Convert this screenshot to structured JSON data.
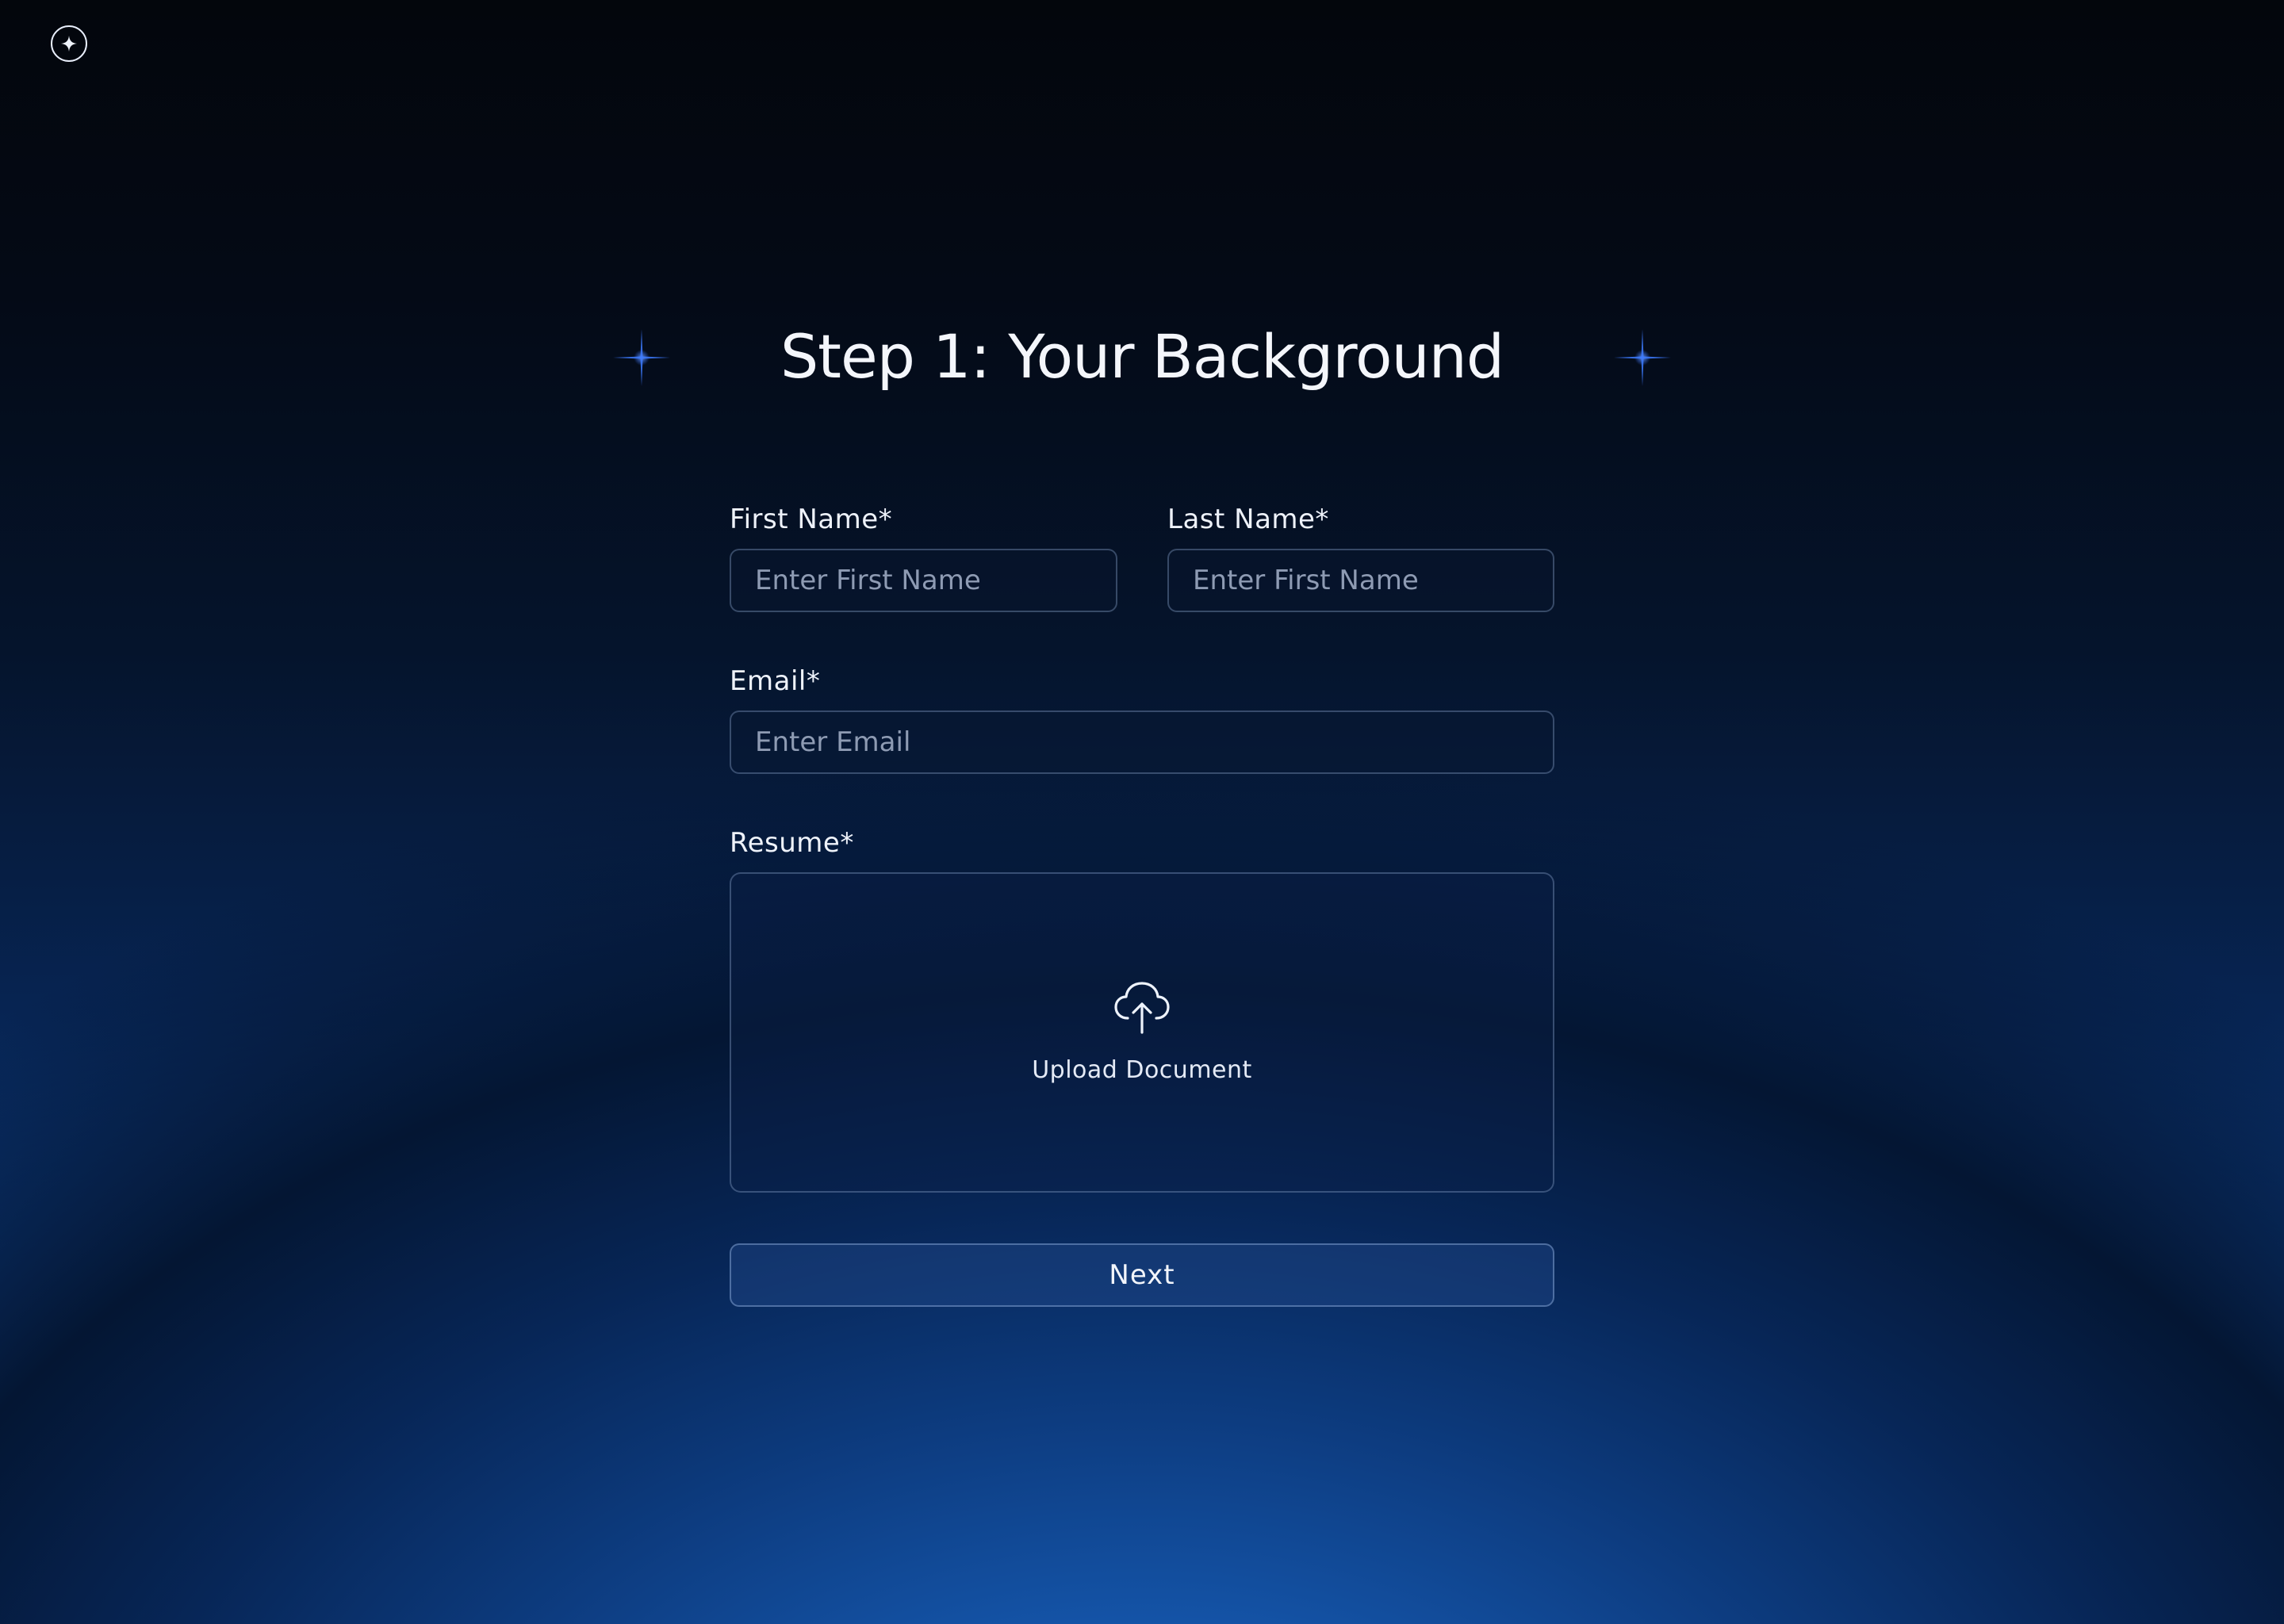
{
  "header": {
    "logo_icon": "sparkle-circle-icon"
  },
  "title": "Step 1: Your Background",
  "form": {
    "first_name": {
      "label": "First Name*",
      "placeholder": "Enter First Name",
      "value": ""
    },
    "last_name": {
      "label": "Last Name*",
      "placeholder": "Enter First Name",
      "value": ""
    },
    "email": {
      "label": "Email*",
      "placeholder": "Enter Email",
      "value": ""
    },
    "resume": {
      "label": "Resume*",
      "upload_text": "Upload Document",
      "icon": "cloud-upload-icon"
    },
    "next_label": "Next"
  },
  "colors": {
    "background_top": "#03060c",
    "background_bottom": "#1d6ed6",
    "accent_sparkle": "#3d7bff",
    "text": "#f2f5fb",
    "placeholder": "#8e9bb3"
  }
}
